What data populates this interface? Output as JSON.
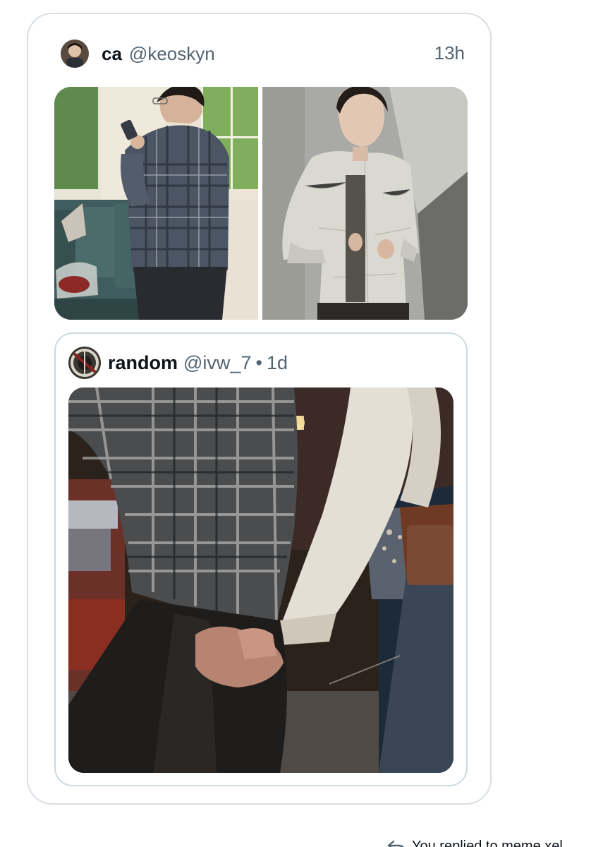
{
  "tweet": {
    "author": {
      "display_name": "ca",
      "handle": "@keoskyn"
    },
    "timestamp": "13h",
    "media": [
      "photo-plaid-shirt-phone",
      "photo-silver-jacket"
    ]
  },
  "quoted_tweet": {
    "author": {
      "display_name": "random",
      "handle": "@ivw_7"
    },
    "separator": "•",
    "timestamp": "1d",
    "media": [
      "photo-holding-hands"
    ]
  },
  "footer": {
    "reply_text": "You replied to meme xel",
    "icon": "reply-arrow-icon"
  },
  "colors": {
    "text_primary": "#0f1419",
    "text_secondary": "#536471",
    "border": "#d9dfe4"
  }
}
